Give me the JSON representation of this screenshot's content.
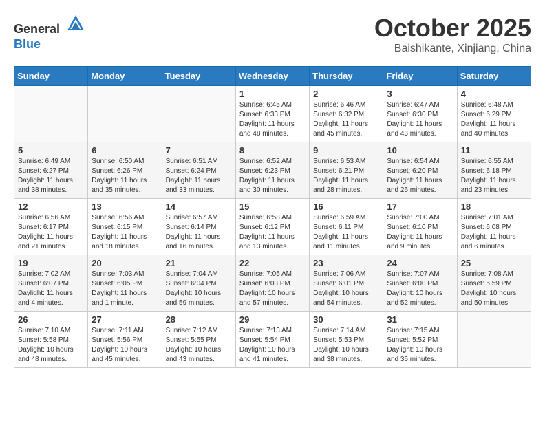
{
  "header": {
    "logo_general": "General",
    "logo_blue": "Blue",
    "month_title": "October 2025",
    "location": "Baishikante, Xinjiang, China"
  },
  "days_of_week": [
    "Sunday",
    "Monday",
    "Tuesday",
    "Wednesday",
    "Thursday",
    "Friday",
    "Saturday"
  ],
  "weeks": [
    [
      {
        "day": "",
        "info": ""
      },
      {
        "day": "",
        "info": ""
      },
      {
        "day": "",
        "info": ""
      },
      {
        "day": "1",
        "info": "Sunrise: 6:45 AM\nSunset: 6:33 PM\nDaylight: 11 hours\nand 48 minutes."
      },
      {
        "day": "2",
        "info": "Sunrise: 6:46 AM\nSunset: 6:32 PM\nDaylight: 11 hours\nand 45 minutes."
      },
      {
        "day": "3",
        "info": "Sunrise: 6:47 AM\nSunset: 6:30 PM\nDaylight: 11 hours\nand 43 minutes."
      },
      {
        "day": "4",
        "info": "Sunrise: 6:48 AM\nSunset: 6:29 PM\nDaylight: 11 hours\nand 40 minutes."
      }
    ],
    [
      {
        "day": "5",
        "info": "Sunrise: 6:49 AM\nSunset: 6:27 PM\nDaylight: 11 hours\nand 38 minutes."
      },
      {
        "day": "6",
        "info": "Sunrise: 6:50 AM\nSunset: 6:26 PM\nDaylight: 11 hours\nand 35 minutes."
      },
      {
        "day": "7",
        "info": "Sunrise: 6:51 AM\nSunset: 6:24 PM\nDaylight: 11 hours\nand 33 minutes."
      },
      {
        "day": "8",
        "info": "Sunrise: 6:52 AM\nSunset: 6:23 PM\nDaylight: 11 hours\nand 30 minutes."
      },
      {
        "day": "9",
        "info": "Sunrise: 6:53 AM\nSunset: 6:21 PM\nDaylight: 11 hours\nand 28 minutes."
      },
      {
        "day": "10",
        "info": "Sunrise: 6:54 AM\nSunset: 6:20 PM\nDaylight: 11 hours\nand 26 minutes."
      },
      {
        "day": "11",
        "info": "Sunrise: 6:55 AM\nSunset: 6:18 PM\nDaylight: 11 hours\nand 23 minutes."
      }
    ],
    [
      {
        "day": "12",
        "info": "Sunrise: 6:56 AM\nSunset: 6:17 PM\nDaylight: 11 hours\nand 21 minutes."
      },
      {
        "day": "13",
        "info": "Sunrise: 6:56 AM\nSunset: 6:15 PM\nDaylight: 11 hours\nand 18 minutes."
      },
      {
        "day": "14",
        "info": "Sunrise: 6:57 AM\nSunset: 6:14 PM\nDaylight: 11 hours\nand 16 minutes."
      },
      {
        "day": "15",
        "info": "Sunrise: 6:58 AM\nSunset: 6:12 PM\nDaylight: 11 hours\nand 13 minutes."
      },
      {
        "day": "16",
        "info": "Sunrise: 6:59 AM\nSunset: 6:11 PM\nDaylight: 11 hours\nand 11 minutes."
      },
      {
        "day": "17",
        "info": "Sunrise: 7:00 AM\nSunset: 6:10 PM\nDaylight: 11 hours\nand 9 minutes."
      },
      {
        "day": "18",
        "info": "Sunrise: 7:01 AM\nSunset: 6:08 PM\nDaylight: 11 hours\nand 6 minutes."
      }
    ],
    [
      {
        "day": "19",
        "info": "Sunrise: 7:02 AM\nSunset: 6:07 PM\nDaylight: 11 hours\nand 4 minutes."
      },
      {
        "day": "20",
        "info": "Sunrise: 7:03 AM\nSunset: 6:05 PM\nDaylight: 11 hours\nand 1 minute."
      },
      {
        "day": "21",
        "info": "Sunrise: 7:04 AM\nSunset: 6:04 PM\nDaylight: 10 hours\nand 59 minutes."
      },
      {
        "day": "22",
        "info": "Sunrise: 7:05 AM\nSunset: 6:03 PM\nDaylight: 10 hours\nand 57 minutes."
      },
      {
        "day": "23",
        "info": "Sunrise: 7:06 AM\nSunset: 6:01 PM\nDaylight: 10 hours\nand 54 minutes."
      },
      {
        "day": "24",
        "info": "Sunrise: 7:07 AM\nSunset: 6:00 PM\nDaylight: 10 hours\nand 52 minutes."
      },
      {
        "day": "25",
        "info": "Sunrise: 7:08 AM\nSunset: 5:59 PM\nDaylight: 10 hours\nand 50 minutes."
      }
    ],
    [
      {
        "day": "26",
        "info": "Sunrise: 7:10 AM\nSunset: 5:58 PM\nDaylight: 10 hours\nand 48 minutes."
      },
      {
        "day": "27",
        "info": "Sunrise: 7:11 AM\nSunset: 5:56 PM\nDaylight: 10 hours\nand 45 minutes."
      },
      {
        "day": "28",
        "info": "Sunrise: 7:12 AM\nSunset: 5:55 PM\nDaylight: 10 hours\nand 43 minutes."
      },
      {
        "day": "29",
        "info": "Sunrise: 7:13 AM\nSunset: 5:54 PM\nDaylight: 10 hours\nand 41 minutes."
      },
      {
        "day": "30",
        "info": "Sunrise: 7:14 AM\nSunset: 5:53 PM\nDaylight: 10 hours\nand 38 minutes."
      },
      {
        "day": "31",
        "info": "Sunrise: 7:15 AM\nSunset: 5:52 PM\nDaylight: 10 hours\nand 36 minutes."
      },
      {
        "day": "",
        "info": ""
      }
    ]
  ]
}
